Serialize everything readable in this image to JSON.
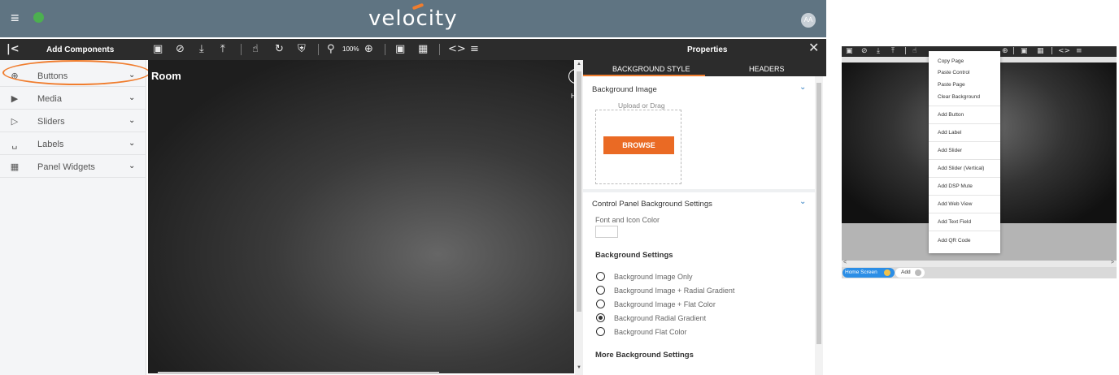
{
  "app": {
    "brand": "velocity",
    "avatar_initials": "AA",
    "colors": {
      "header": "#5f7482",
      "toolbar": "#2c2c2c",
      "accent": "#f07d2e",
      "browse": "#ea6a24",
      "tab_active": "#2b8ee6"
    }
  },
  "toolbar": {
    "collapse_icon": "collapse-left-icon",
    "add_components_title": "Add Components",
    "zoom_level": "100%",
    "properties_title": "Properties",
    "close_icon": "close-icon"
  },
  "sidebar": {
    "items": [
      {
        "label": "Buttons",
        "icon": "plus-circle-icon"
      },
      {
        "label": "Media",
        "icon": "play-circle-icon"
      },
      {
        "label": "Sliders",
        "icon": "volume-icon"
      },
      {
        "label": "Labels",
        "icon": "label-icon"
      },
      {
        "label": "Panel Widgets",
        "icon": "widgets-icon"
      }
    ]
  },
  "canvas": {
    "page_title": "Room",
    "edge_text": "H"
  },
  "properties": {
    "tabs": [
      "BACKGROUND STYLE",
      "HEADERS"
    ],
    "background_image": {
      "title": "Background Image",
      "upload_text": "Upload or Drag",
      "browse_label": "BROWSE"
    },
    "control_panel": {
      "title": "Control Panel Background Settings",
      "font_color_label": "Font and Icon Color",
      "bg_settings_title": "Background Settings",
      "options": [
        "Background Image Only",
        "Background Image + Radial Gradient",
        "Background Image + Flat Color",
        "Background Radial Gradient",
        "Background Flat Color"
      ],
      "selected_option": "Background Radial Gradient",
      "more_title": "More Background Settings"
    }
  },
  "preview": {
    "context_menu": [
      "Copy Page",
      "Paste Control",
      "Paste Page",
      "Clear Background",
      "Add Button",
      "Add Label",
      "Add Slider",
      "Add Slider (Vertical)",
      "Add DSP Mute",
      "Add Web View",
      "Add Text Field",
      "Add QR Code"
    ],
    "tabs": [
      "Home Screen",
      "Add"
    ]
  }
}
